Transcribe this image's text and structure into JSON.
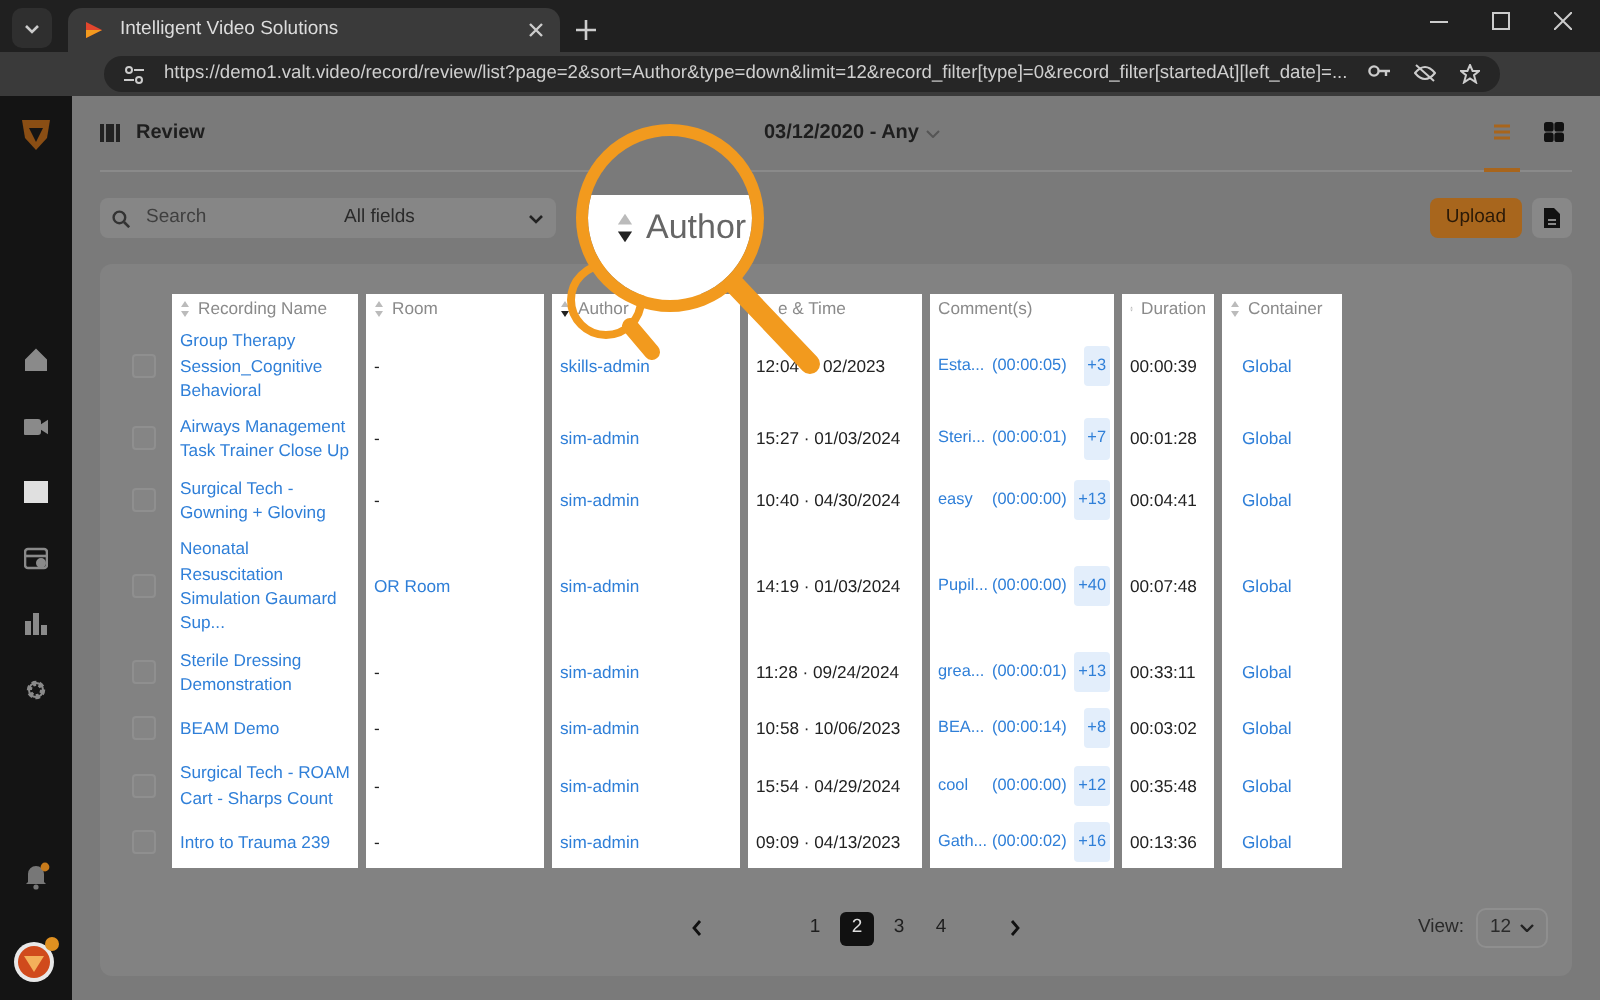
{
  "browser": {
    "tab_title": "Intelligent Video Solutions",
    "url": "https://demo1.valt.video/record/review/list?page=2&sort=Author&type=down&limit=12&record_filter[type]=0&record_filter[startedAt][left_date]=..."
  },
  "sidebar": {
    "items": [
      {
        "kind": "home",
        "selected": false
      },
      {
        "kind": "video",
        "selected": false
      },
      {
        "kind": "film",
        "selected": true
      },
      {
        "kind": "schedule",
        "selected": false
      },
      {
        "kind": "chart",
        "selected": false
      },
      {
        "kind": "gear",
        "selected": false
      }
    ],
    "notifications_unread": true
  },
  "header": {
    "title": "Review",
    "date_filter": "03/12/2020 - Any",
    "views": [
      {
        "kind": "list",
        "selected": true
      },
      {
        "kind": "grid",
        "selected": false
      }
    ]
  },
  "toolbar": {
    "search": {
      "placeholder": "Search"
    },
    "field_filter": "All fields",
    "upload": "Upload"
  },
  "table": {
    "columns": [
      {
        "label": "Recording Name",
        "sortable": true
      },
      {
        "label": "Room",
        "sortable": true
      },
      {
        "label": "Author",
        "sortable": true,
        "descending": true
      },
      {
        "label": "e & Time",
        "sortable": false
      },
      {
        "label": "Comment(s)",
        "sortable": false
      },
      {
        "label": "Duration",
        "sortable": true
      },
      {
        "label": "Container",
        "sortable": true
      }
    ],
    "rows": [
      {
        "checked": false,
        "name": "Group Therapy Session_Cognitive Behavioral",
        "room": "-",
        "author": "skills-admin",
        "datetime": "12:04",
        "datetime_tail": "02/2023",
        "comment": "Esta...",
        "comment_time": "(00:00:05)",
        "more": "+3",
        "duration": "00:00:39",
        "container": "Global"
      },
      {
        "checked": false,
        "name": "Airways Management Task Trainer Close Up",
        "room": "-",
        "author": "sim-admin",
        "datetime": "15:27 · 01/03/2024",
        "comment": "Steri...",
        "comment_time": "(00:00:01)",
        "more": "+7",
        "duration": "00:01:28",
        "container": "Global"
      },
      {
        "checked": false,
        "name": "Surgical Tech - Gowning + Gloving",
        "room": "-",
        "author": "sim-admin",
        "datetime": "10:40 · 04/30/2024",
        "comment": "easy",
        "comment_time": "(00:00:00)",
        "more": "+13",
        "duration": "00:04:41",
        "container": "Global"
      },
      {
        "checked": false,
        "name": "Neonatal Resuscitation Simulation Gaumard Sup...",
        "room": "OR Room",
        "author": "sim-admin",
        "datetime": "14:19 · 01/03/2024",
        "comment": "Pupil...",
        "comment_time": "(00:00:00)",
        "more": "+40",
        "duration": "00:07:48",
        "container": "Global"
      },
      {
        "checked": false,
        "name": "Sterile Dressing Demonstration",
        "room": "-",
        "author": "sim-admin",
        "datetime": "11:28 · 09/24/2024",
        "comment": "grea...",
        "comment_time": "(00:00:01)",
        "more": "+13",
        "duration": "00:33:11",
        "container": "Global"
      },
      {
        "checked": false,
        "name": "BEAM Demo",
        "room": "-",
        "author": "sim-admin",
        "datetime": "10:58 · 10/06/2023",
        "comment": "BEA...",
        "comment_time": "(00:00:14)",
        "more": "+8",
        "duration": "00:03:02",
        "container": "Global"
      },
      {
        "checked": false,
        "name": "Surgical Tech - ROAM Cart - Sharps Count",
        "room": "-",
        "author": "sim-admin",
        "datetime": "15:54 · 04/29/2024",
        "comment": "cool",
        "comment_time": "(00:00:00)",
        "more": "+12",
        "duration": "00:35:48",
        "container": "Global"
      },
      {
        "checked": false,
        "name": "Intro to Trauma 239",
        "room": "-",
        "author": "sim-admin",
        "datetime": "09:09 · 04/13/2023",
        "comment": "Gath...",
        "comment_time": "(00:00:02)",
        "more": "+16",
        "duration": "00:13:36",
        "container": "Global"
      }
    ]
  },
  "callout": {
    "label": "Author",
    "descending": true
  },
  "pagination": {
    "pages": [
      {
        "label": "1",
        "selected": false
      },
      {
        "label": "2",
        "selected": true
      },
      {
        "label": "3",
        "selected": false
      },
      {
        "label": "4",
        "selected": false
      }
    ]
  },
  "page_size": {
    "label": "View:",
    "value": "12"
  }
}
